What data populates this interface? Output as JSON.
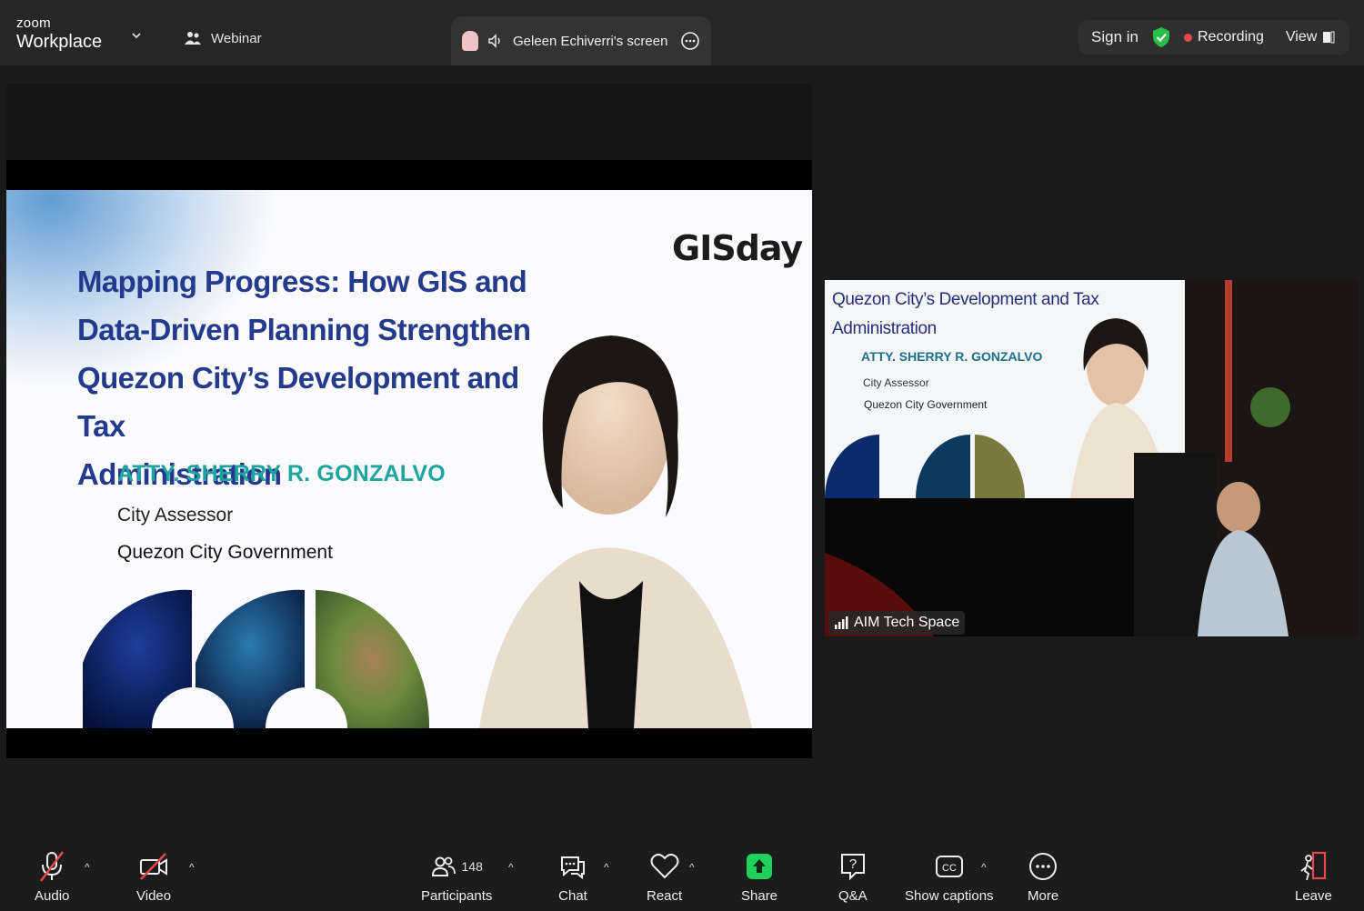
{
  "topbar": {
    "brand_small": "zoom",
    "brand_large": "Workplace",
    "webinar_label": "Webinar",
    "share_label": "Geleen Echiverri's screen",
    "sign_in": "Sign in",
    "recording": "Recording",
    "view": "View"
  },
  "slide": {
    "logo": "GISday",
    "title_lines": [
      "Mapping Progress: How GIS and",
      "Data-Driven Planning Strengthen",
      "Quezon City’s Development and Tax",
      "Administration"
    ],
    "speaker_name": "ATTY. SHERRY R. GONZALVO",
    "speaker_role": "City Assessor",
    "speaker_org": "Quezon City Government"
  },
  "camera": {
    "slide_title_line1": "Quezon City’s Development and Tax",
    "slide_title_line2": "Administration",
    "slide_name": "ATTY. SHERRY R. GONZALVO",
    "slide_role": "City Assessor",
    "slide_org": "Quezon City Government",
    "participant_label": "AIM Tech Space"
  },
  "toolbar": {
    "audio": "Audio",
    "video": "Video",
    "participants": "Participants",
    "participants_count": "148",
    "chat": "Chat",
    "react": "React",
    "share": "Share",
    "qa": "Q&A",
    "captions": "Show captions",
    "more": "More",
    "leave": "Leave"
  },
  "colors": {
    "share_green": "#1fd15a",
    "leave_red": "#e5484d",
    "record_red": "#e5484d",
    "shield_green": "#2bbd4a",
    "title_blue": "#243a8c",
    "name_teal": "#1ea5a0"
  }
}
